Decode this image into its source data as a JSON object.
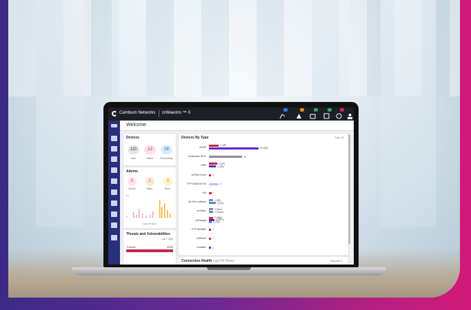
{
  "topbar": {
    "brand": "Cambium Networks",
    "product": "cnMaestro ™ X"
  },
  "page": {
    "title": "Welcome"
  },
  "devices": {
    "title": "Devices",
    "total": "110",
    "total_label": "Total",
    "offline": "12",
    "offline_label": "Offline",
    "onboarding": "28",
    "onboarding_label": "Onboarding"
  },
  "alarms": {
    "title": "Alarms",
    "critical": "0",
    "critical_label": "Critical",
    "major": "1",
    "major_label": "Major",
    "minor": "0",
    "minor_label": "Minor",
    "axis_top": "12",
    "axis_bottom": "0",
    "caption": "Last 24 Hours"
  },
  "threats": {
    "title": "Threats and Vulnerabilities",
    "period": "Last 7 Days",
    "row_label": "Threats",
    "row_value": "4905"
  },
  "devices_by_type": {
    "title": "Devices By Type",
    "total": "Total: 110",
    "rows": [
      {
        "name": "ePMP",
        "bars": [
          "1 (AP)",
          "31 (SM)"
        ]
      },
      {
        "name": "Enterprise Wi-Fi",
        "bars": [
          "26"
        ]
      },
      {
        "name": "PMP",
        "bars": [
          "1 (AP)",
          "1 (SM)"
        ]
      },
      {
        "name": "cnPilot Home",
        "bars": [
          "3"
        ]
      },
      {
        "name": "PTP 650/670/700",
        "bars": [
          "3"
        ]
      },
      {
        "name": "MX",
        "bars": [
          "1"
        ]
      },
      {
        "name": "60 GHz cnWave",
        "bars": [
          "1 (DN)",
          "3 (CN)"
        ]
      },
      {
        "name": "cnVision",
        "bars": [
          "2 (Hub)",
          "2 (Client)"
        ]
      },
      {
        "name": "cnRanger",
        "bars": [
          "2 (BBU)",
          "3 (RRH)",
          "1 (SM)"
        ]
      },
      {
        "name": "PTP 820/850",
        "bars": [
          "2"
        ]
      },
      {
        "name": "cnReach",
        "bars": [
          "2"
        ]
      },
      {
        "name": "cnMatrix",
        "bars": [
          "1"
        ]
      }
    ]
  },
  "connection": {
    "title": "Connection Health",
    "subtitle": "Last 24 Hours",
    "right": "Response Ti..."
  },
  "colors": {
    "accent_purple": "#5a28c8",
    "accent_red": "#c8244a",
    "side_nav": "#2a2f7a",
    "offline": "#e85a6a",
    "onboarding": "#3a8ad8"
  }
}
